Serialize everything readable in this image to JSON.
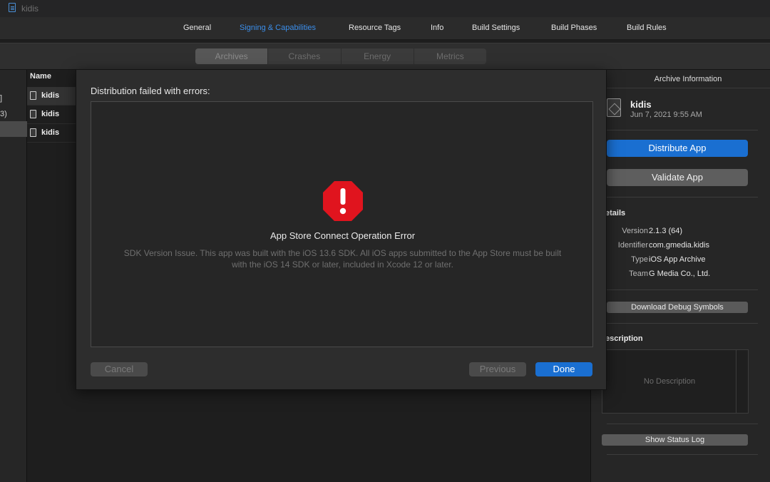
{
  "titlebar": {
    "icon": "file-icon",
    "title": "kidis"
  },
  "tabs": [
    {
      "label": "General",
      "active": false
    },
    {
      "label": "Signing & Capabilities",
      "active": true
    },
    {
      "label": "Resource Tags",
      "active": false
    },
    {
      "label": "Info",
      "active": false
    },
    {
      "label": "Build Settings",
      "active": false
    },
    {
      "label": "Build Phases",
      "active": false
    },
    {
      "label": "Build Rules",
      "active": false
    }
  ],
  "organizer": {
    "segments": [
      {
        "label": "Archives",
        "active": true
      },
      {
        "label": "Crashes",
        "active": false
      },
      {
        "label": "Energy",
        "active": false
      },
      {
        "label": "Metrics",
        "active": false
      }
    ],
    "left_fragments": [
      "]",
      "3)"
    ],
    "name_column": {
      "header": "Name",
      "rows": [
        "kidis",
        "kidis",
        "kidis"
      ]
    }
  },
  "inspector": {
    "header": "Archive Information",
    "app_name": "kidis",
    "app_date": "Jun 7, 2021 9:55 AM",
    "distribute_label": "Distribute App",
    "validate_label": "Validate App",
    "details_title": "etails",
    "details": [
      {
        "key": "Version",
        "value": "2.1.3 (64)"
      },
      {
        "key": "Identifier",
        "value": "com.gmedia.kidis"
      },
      {
        "key": "Type",
        "value": "iOS App Archive"
      },
      {
        "key": "Team",
        "value": "G Media Co., Ltd."
      }
    ],
    "debug_symbols_label": "Download Debug Symbols",
    "description_title": "escription",
    "description_placeholder": "No Description",
    "status_log_label": "Show Status Log"
  },
  "sheet": {
    "title": "Distribution failed with errors:",
    "error_icon": "error-stop-sign-icon",
    "error_title": "App Store Connect Operation Error",
    "error_message": "SDK Version Issue. This app was built with the iOS 13.6 SDK. All iOS apps submitted to the App Store must be built with the iOS 14 SDK or later, included in Xcode 12 or later.",
    "cancel_label": "Cancel",
    "previous_label": "Previous",
    "done_label": "Done"
  },
  "colors": {
    "accent_blue": "#1a6fd1",
    "link_blue": "#3b8eea",
    "error_red": "#e0141e"
  }
}
